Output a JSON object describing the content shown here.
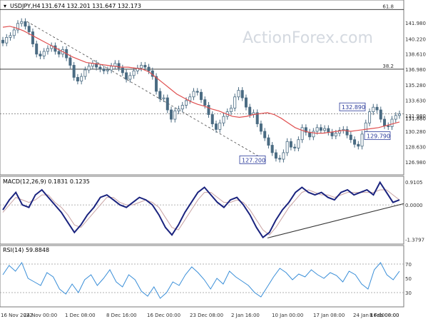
{
  "header": {
    "symbol": "USDJPY,H4",
    "ohlc": "131.674 132.201 131.647 132.173",
    "watermark": "ActionForex.com"
  },
  "colors": {
    "candle": "#4a6b82",
    "candle_fill": "#ffffff",
    "sma": "#e05050",
    "macd_line": "#1a237e",
    "signal_line": "#c9a3a3",
    "rsi_line": "#3b8fd8",
    "fib": "#222222",
    "grid": "#bdbdbd",
    "box_border": "#2a3a9a"
  },
  "x_axis": {
    "labels": [
      "16 Nov 2022",
      "24 Nov 00:00",
      "1 Dec 08:00",
      "8 Dec 16:00",
      "16 Dec 00:00",
      "23 Dec 08:00",
      "2 Jan 16:00",
      "10 Jan 00:00",
      "17 Jan 08:00",
      "24 Jan 16:00",
      "1 Feb 00:00",
      "8 Feb 08:00"
    ]
  },
  "chart_data": [
    {
      "type": "line",
      "name": "price",
      "title": "USDJPY,H4",
      "ylim": [
        126.0,
        143.5
      ],
      "y_ticks": [
        "141.980",
        "140.220",
        "138.610",
        "136.980",
        "135.280",
        "133.630",
        "131.980",
        "130.280",
        "128.630",
        "126.980"
      ],
      "current_price": "132.173",
      "last_price_label": "131.880",
      "series": [
        {
          "values": [
            139.8,
            140.4,
            140.6,
            141.2,
            141.9,
            142.1,
            141.6,
            141.0,
            139.7,
            138.6,
            138.4,
            138.9,
            139.2,
            139.5,
            138.9,
            138.6,
            139.1,
            138.2,
            137.4,
            136.1,
            135.7,
            136.2,
            136.9,
            137.3,
            137.6,
            137.2,
            137.0,
            136.8,
            136.9,
            137.3,
            137.6,
            137.1,
            136.6,
            135.9,
            136.3,
            136.8,
            137.1,
            137.4,
            137.2,
            136.8,
            136.2,
            134.6,
            133.8,
            133.9,
            132.6,
            131.6,
            132.5,
            132.7,
            133.1,
            133.6,
            134.0,
            134.6,
            134.5,
            133.7,
            133.1,
            132.1,
            131.1,
            130.5,
            131.2,
            131.9,
            132.4,
            132.8,
            134.0,
            134.7,
            133.9,
            132.9,
            132.1,
            132.3,
            131.1,
            130.3,
            129.6,
            128.8,
            128.0,
            127.4,
            127.3,
            128.0,
            129.2,
            128.6,
            128.5,
            129.4,
            130.7,
            130.2,
            129.7,
            130.3,
            130.7,
            130.4,
            130.6,
            130.2,
            129.8,
            130.1,
            130.4,
            130.5,
            129.9,
            129.4,
            128.9,
            128.7,
            130.0,
            131.2,
            132.4,
            132.89,
            132.6,
            131.6,
            130.9,
            130.8,
            131.6,
            132.0,
            132.17
          ]
        },
        {
          "name": "SMA",
          "values": [
            141.5,
            141.6,
            141.4,
            141.1,
            140.7,
            140.3,
            139.9,
            139.5,
            139.1,
            138.7,
            138.3,
            138.0,
            137.7,
            137.6,
            137.5,
            137.4,
            137.3,
            137.2,
            137.2,
            137.1,
            137.0,
            136.7,
            136.1,
            135.5,
            134.9,
            134.3,
            133.9,
            133.5,
            133.2,
            133.0,
            132.7,
            132.5,
            132.2,
            131.9,
            131.8,
            131.9,
            132.1,
            132.2,
            132.3,
            132.1,
            131.7,
            131.2,
            130.7,
            130.4,
            130.2,
            130.1,
            130.1,
            130.2,
            130.3,
            130.4,
            130.3,
            130.4,
            130.5,
            130.6,
            130.7,
            130.9,
            131.1,
            131.3
          ]
        }
      ],
      "annotations": [
        {
          "label": "132.890",
          "x_label": "1 Feb 00:00",
          "y": 132.89
        },
        {
          "label": "129.790",
          "x_label": "8 Feb 08:00",
          "y": 129.79
        },
        {
          "label": "127.200",
          "x_label": "10 Jan 00:00",
          "y": 127.2
        }
      ],
      "fib_levels": [
        {
          "label": "61.8",
          "y": 143.4
        },
        {
          "label": "38.2",
          "y": 136.98
        }
      ]
    },
    {
      "type": "line",
      "title": "MACD(12,26,9) 0.1831 0.1235",
      "ylim": [
        -1.45,
        1.0
      ],
      "y_ticks": [
        "0.9105",
        "0.0000",
        "-1.3797"
      ],
      "series": [
        {
          "values": [
            -0.2,
            0.2,
            0.5,
            0.0,
            -0.1,
            0.4,
            0.6,
            0.3,
            0.0,
            -0.3,
            -0.7,
            -1.1,
            -0.8,
            -0.4,
            -0.1,
            0.3,
            0.4,
            0.2,
            0.0,
            -0.1,
            0.1,
            0.3,
            0.2,
            0.0,
            -0.4,
            -0.9,
            -1.2,
            -0.8,
            -0.3,
            0.1,
            0.5,
            0.7,
            0.4,
            0.1,
            -0.1,
            0.2,
            0.3,
            0.0,
            -0.4,
            -0.9,
            -1.3,
            -1.1,
            -0.6,
            -0.2,
            0.1,
            0.5,
            0.7,
            0.5,
            0.4,
            0.5,
            0.3,
            0.2,
            0.5,
            0.6,
            0.4,
            0.5,
            0.6,
            0.4,
            0.9,
            0.5,
            0.1,
            0.2
          ]
        },
        {
          "values": [
            -0.3,
            0.0,
            0.3,
            0.2,
            0.1,
            0.2,
            0.4,
            0.4,
            0.1,
            -0.1,
            -0.4,
            -0.8,
            -0.9,
            -0.6,
            -0.3,
            0.0,
            0.3,
            0.3,
            0.1,
            0.0,
            0.0,
            0.1,
            0.2,
            0.1,
            -0.1,
            -0.5,
            -0.9,
            -1.0,
            -0.6,
            -0.2,
            0.2,
            0.5,
            0.5,
            0.3,
            0.1,
            0.1,
            0.2,
            0.1,
            -0.2,
            -0.6,
            -1.0,
            -1.2,
            -0.9,
            -0.5,
            -0.1,
            0.2,
            0.5,
            0.6,
            0.5,
            0.4,
            0.4,
            0.3,
            0.4,
            0.5,
            0.5,
            0.5,
            0.5,
            0.5,
            0.6,
            0.6,
            0.4,
            0.2
          ]
        }
      ]
    },
    {
      "type": "line",
      "title": "RSI(14) 59.8848",
      "ylim": [
        12,
        88
      ],
      "y_ticks": [
        "70",
        "50",
        "30"
      ],
      "series": [
        {
          "values": [
            55,
            68,
            60,
            72,
            50,
            45,
            40,
            58,
            52,
            35,
            28,
            42,
            30,
            48,
            55,
            40,
            50,
            62,
            45,
            38,
            55,
            48,
            32,
            25,
            38,
            22,
            30,
            45,
            40,
            55,
            66,
            58,
            48,
            35,
            50,
            42,
            60,
            52,
            46,
            40,
            30,
            24,
            38,
            52,
            64,
            58,
            48,
            56,
            52,
            62,
            55,
            50,
            58,
            54,
            45,
            60,
            55,
            42,
            35,
            62,
            72,
            55,
            48,
            60
          ]
        }
      ]
    }
  ]
}
